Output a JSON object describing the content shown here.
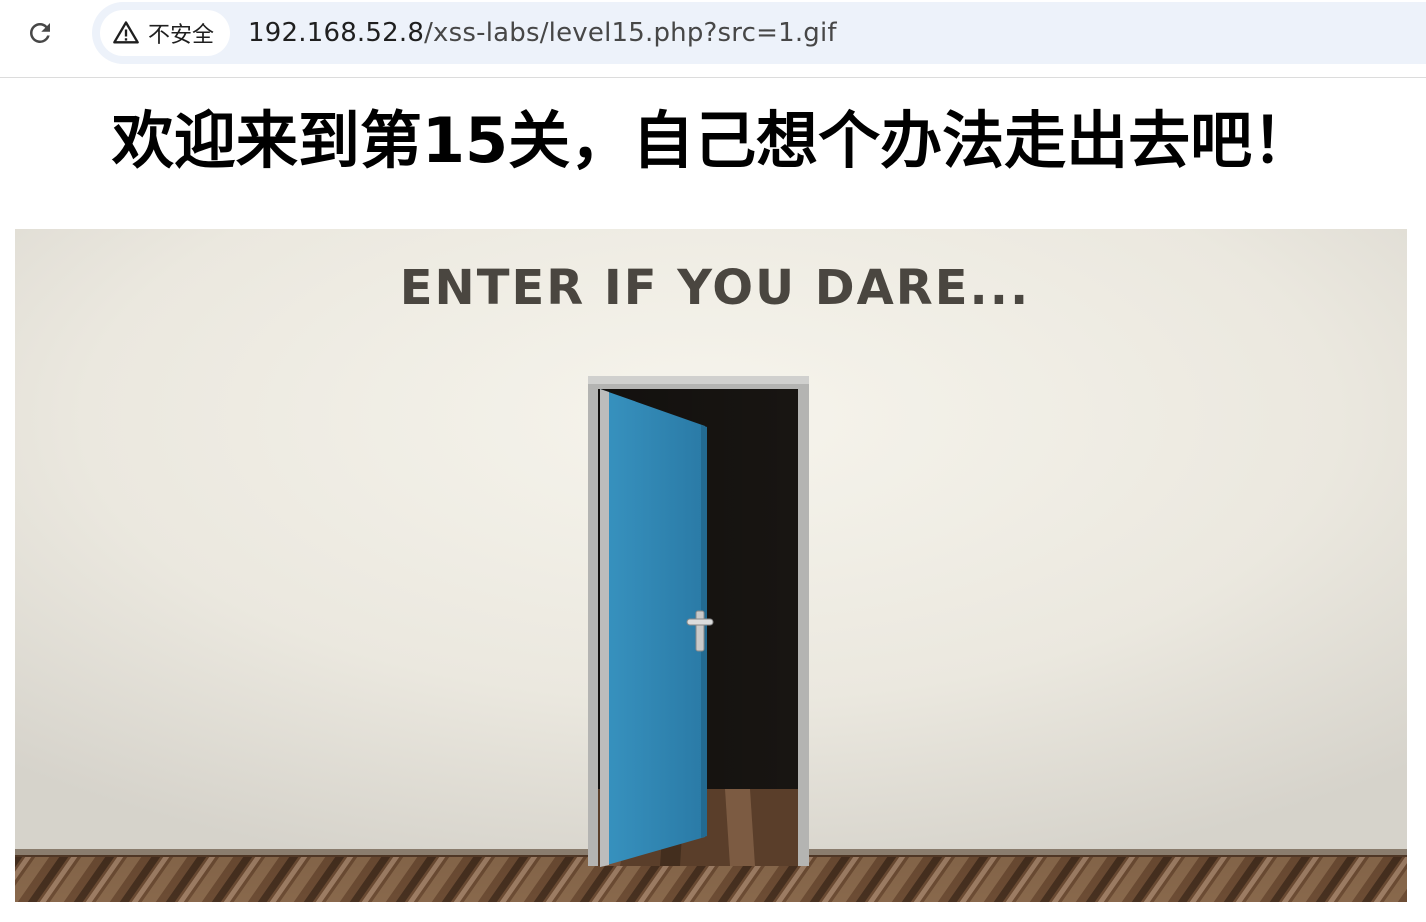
{
  "browser": {
    "reload_icon": "reload-icon",
    "security": {
      "icon": "warning-triangle-icon",
      "label": "不安全"
    },
    "url": {
      "host": "192.168.52.8",
      "path": "/xss-labs/level15.php?src=1.gif"
    }
  },
  "page": {
    "title": "欢迎来到第15关，自己想个办法走出去吧！",
    "image": {
      "caption_text": "ENTER IF YOU DARE...",
      "colors": {
        "wall": "#eeece4",
        "door": "#2f86b3",
        "doorway": "#1a1714",
        "frame": "#a9a9a9",
        "floor": "#6b4a33"
      }
    }
  }
}
